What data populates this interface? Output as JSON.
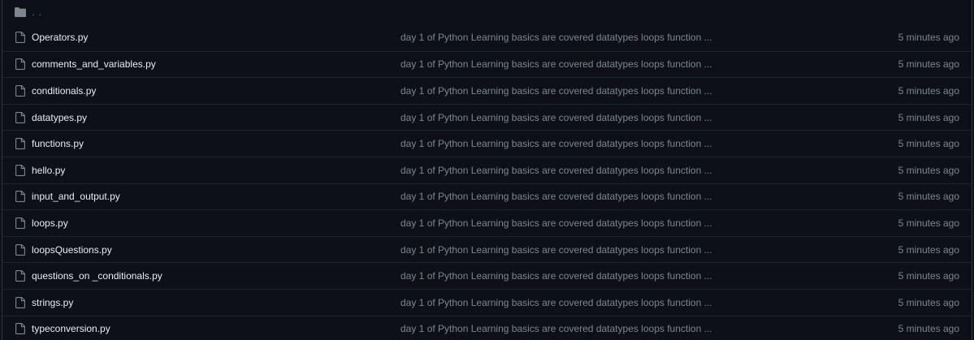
{
  "parent_row": {
    "icon": "folder-icon",
    "label": ". ."
  },
  "files": [
    {
      "icon": "file-icon",
      "name": "Operators.py",
      "commit": "day 1 of Python Learning basics are covered datatypes loops function ...",
      "age": "5 minutes ago"
    },
    {
      "icon": "file-icon",
      "name": "comments_and_variables.py",
      "commit": "day 1 of Python Learning basics are covered datatypes loops function ...",
      "age": "5 minutes ago"
    },
    {
      "icon": "file-icon",
      "name": "conditionals.py",
      "commit": "day 1 of Python Learning basics are covered datatypes loops function ...",
      "age": "5 minutes ago"
    },
    {
      "icon": "file-icon",
      "name": "datatypes.py",
      "commit": "day 1 of Python Learning basics are covered datatypes loops function ...",
      "age": "5 minutes ago"
    },
    {
      "icon": "file-icon",
      "name": "functions.py",
      "commit": "day 1 of Python Learning basics are covered datatypes loops function ...",
      "age": "5 minutes ago"
    },
    {
      "icon": "file-icon",
      "name": "hello.py",
      "commit": "day 1 of Python Learning basics are covered datatypes loops function ...",
      "age": "5 minutes ago"
    },
    {
      "icon": "file-icon",
      "name": "input_and_output.py",
      "commit": "day 1 of Python Learning basics are covered datatypes loops function ...",
      "age": "5 minutes ago"
    },
    {
      "icon": "file-icon",
      "name": "loops.py",
      "commit": "day 1 of Python Learning basics are covered datatypes loops function ...",
      "age": "5 minutes ago"
    },
    {
      "icon": "file-icon",
      "name": "loopsQuestions.py",
      "commit": "day 1 of Python Learning basics are covered datatypes loops function ...",
      "age": "5 minutes ago"
    },
    {
      "icon": "file-icon",
      "name": "questions_on _conditionals.py",
      "commit": "day 1 of Python Learning basics are covered datatypes loops function ...",
      "age": "5 minutes ago"
    },
    {
      "icon": "file-icon",
      "name": "strings.py",
      "commit": "day 1 of Python Learning basics are covered datatypes loops function ...",
      "age": "5 minutes ago"
    },
    {
      "icon": "file-icon",
      "name": "typeconversion.py",
      "commit": "day 1 of Python Learning basics are covered datatypes loops function ...",
      "age": "5 minutes ago"
    }
  ],
  "colors": {
    "background": "#0d1117",
    "border": "#21262d",
    "text": "#e6edf3",
    "muted": "#7d8590",
    "link": "#2f81f7"
  }
}
